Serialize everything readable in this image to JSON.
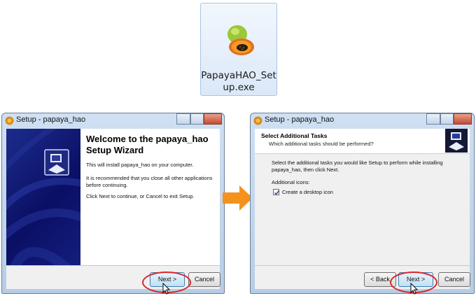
{
  "file_icon": {
    "filename": "PapayaHAO_Set­up.exe",
    "line1": "PapayaHAO_Set",
    "line2": "up.exe"
  },
  "left_window": {
    "title": "Setup - papaya_hao",
    "heading": "Welcome to the papaya_hao Setup Wizard",
    "para1": "This will install papaya_hao on your computer.",
    "para2": "It is recommended that you close all other applications before continuing.",
    "para3": "Click Next to continue, or Cancel to exit Setup.",
    "next_label": "Next >",
    "cancel_label": "Cancel"
  },
  "right_window": {
    "title": "Setup - papaya_hao",
    "header_title": "Select Additional Tasks",
    "header_subtitle": "Which additional tasks should be performed?",
    "instruction": "Select the additional tasks you would like Setup to perform while installing papaya_hao, then click Next.",
    "group_label": "Additional icons:",
    "checkbox_label": "Create a desktop icon",
    "checkbox_checked": true,
    "back_label": "< Back",
    "next_label": "Next >",
    "cancel_label": "Cancel"
  },
  "colors": {
    "highlight": "#d9262b",
    "arrow": "#f5921e",
    "banner": "#0a0f64"
  },
  "icons": [
    "papaya-icon",
    "setup-icon",
    "computer-box-icon",
    "arrow-right-icon",
    "cursor-icon",
    "check-icon"
  ]
}
